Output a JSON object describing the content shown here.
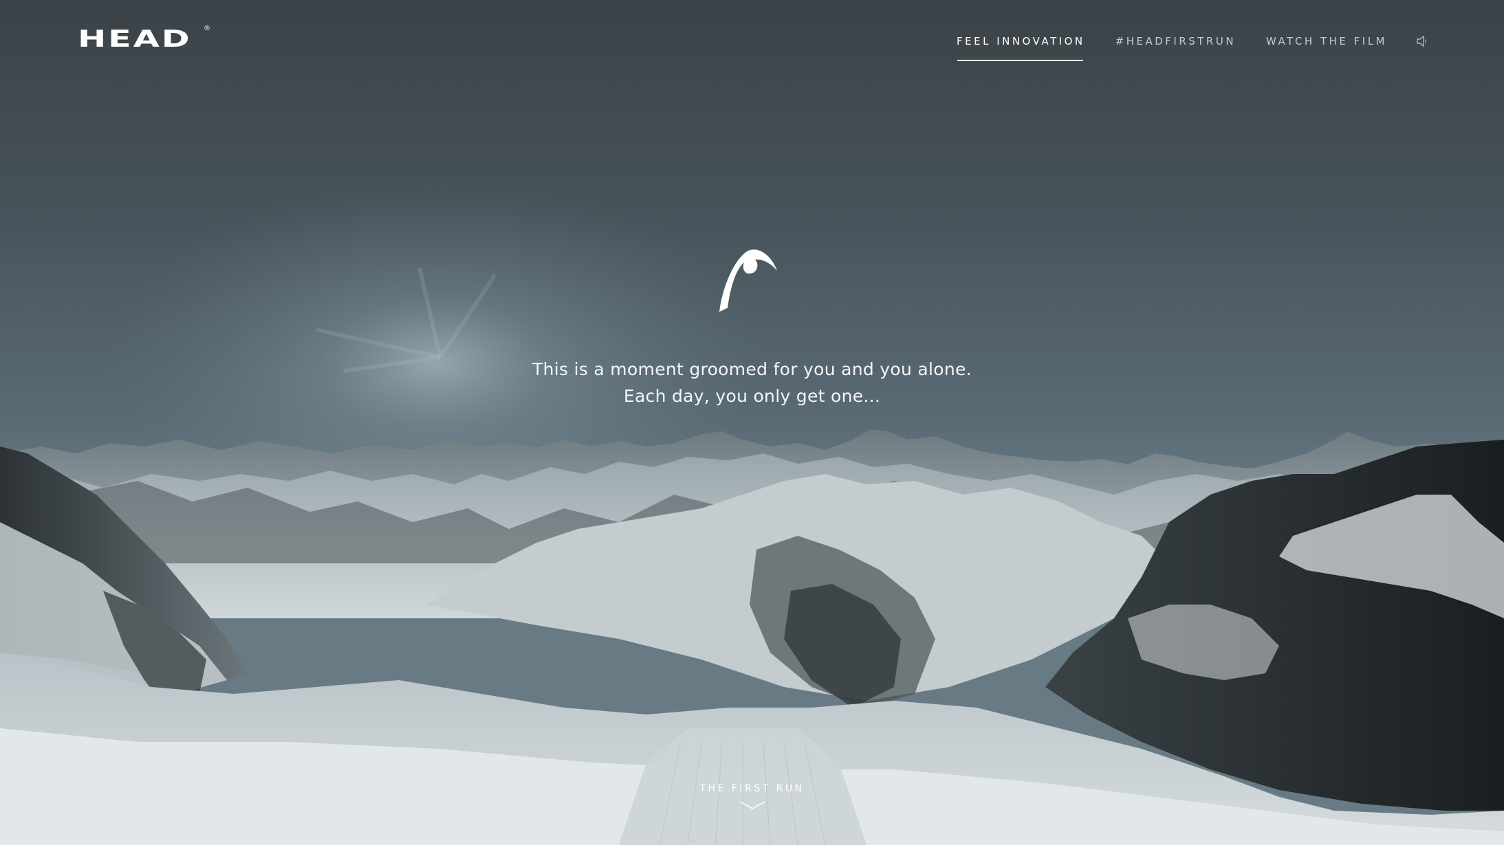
{
  "brand": {
    "logo_text": "HEAD",
    "registered_mark": "®"
  },
  "nav": {
    "items": [
      {
        "label": "FEEL INNOVATION",
        "active": true
      },
      {
        "label": "#HEADFIRSTRUN",
        "active": false
      },
      {
        "label": "WATCH THE FILM",
        "active": false
      }
    ],
    "sound_icon": "speaker-icon"
  },
  "hero": {
    "mark_icon": "head-logo-mark-icon",
    "line1": "This is a moment groomed for you and you alone.",
    "line2": "Each day, you only get one..."
  },
  "scroll": {
    "label": "THE FIRST RUN",
    "icon": "chevron-down-icon"
  },
  "colors": {
    "sky_top": "#3c4449",
    "sky_mid": "#566670",
    "snow": "#d9dfe2",
    "rock": "#1f2326"
  }
}
